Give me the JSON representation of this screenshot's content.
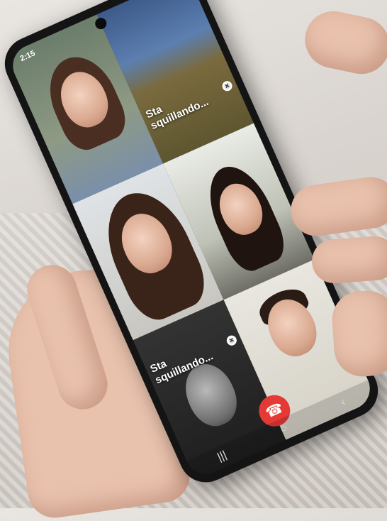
{
  "status_bar": {
    "time": "2:15",
    "icons": [
      "wifi-icon",
      "signal-icon",
      "battery-icon"
    ]
  },
  "tiles": [
    {
      "id": "participant-1",
      "label": ""
    },
    {
      "id": "participant-2",
      "label": "Sta squillando..."
    },
    {
      "id": "participant-3",
      "label": ""
    },
    {
      "id": "participant-4",
      "label": ""
    },
    {
      "id": "participant-5",
      "label": "Sta squillando..."
    },
    {
      "id": "participant-6",
      "label": ""
    }
  ],
  "close_glyph": "×",
  "end_call_glyph": "☎",
  "nav": {
    "recents": "|||",
    "home": "○",
    "back": "‹"
  },
  "colors": {
    "end_call": "#e53935",
    "phone_body": "#141414"
  }
}
